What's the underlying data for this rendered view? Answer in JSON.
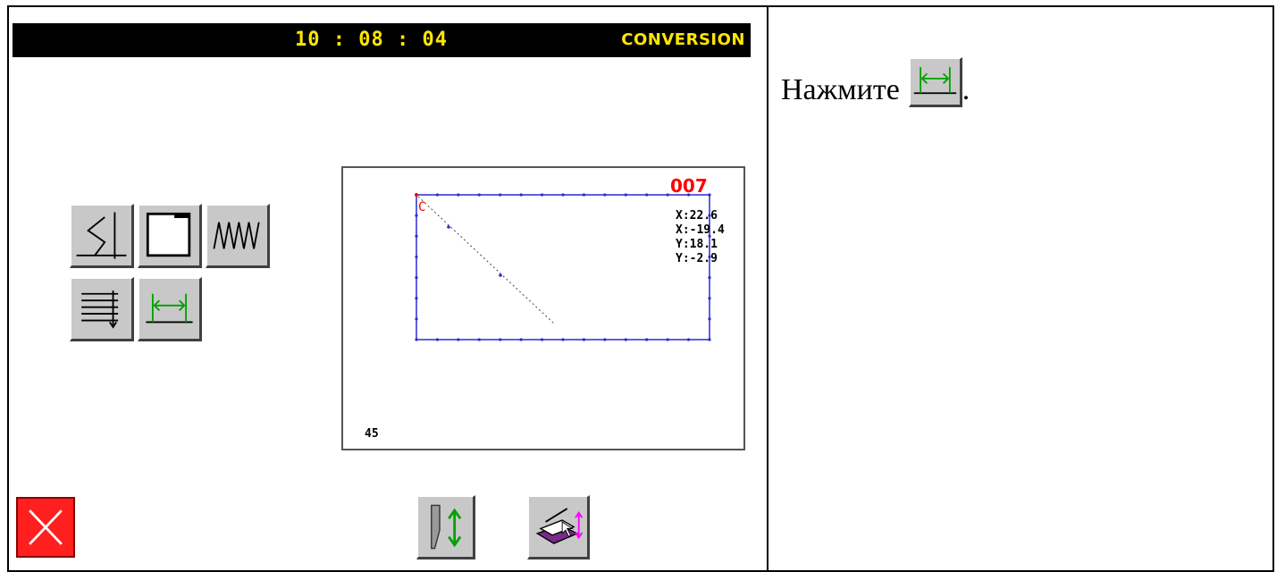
{
  "header": {
    "clock": "10 : 08 : 04",
    "mode": "CONVERSION"
  },
  "preview": {
    "pattern_number": "007",
    "coords": [
      "X:22.6",
      "X:-19.4",
      "Y:18.1",
      "Y:-2.9"
    ],
    "stitch_count": "45",
    "start_marker": "C"
  },
  "tools": [
    "zigzag-stitch-icon",
    "rectangle-frame-icon",
    "multi-zigzag-icon",
    "multi-line-fill-icon",
    "width-extend-icon"
  ],
  "bottom_buttons": [
    "needle-updown-icon",
    "presser-lift-icon"
  ],
  "cancel": "close-icon",
  "instruction": {
    "text": "Нажмите",
    "suffix": ".",
    "button_icon": "width-extend-icon"
  },
  "colors": {
    "titlebar_bg": "#000000",
    "titlebar_text": "#ffe600",
    "button_face": "#c8c8c8",
    "pattern_outline": "#2a2ad0",
    "accent_red": "#ff0000",
    "accent_green": "#00a000",
    "accent_magenta": "#ff00ff"
  }
}
